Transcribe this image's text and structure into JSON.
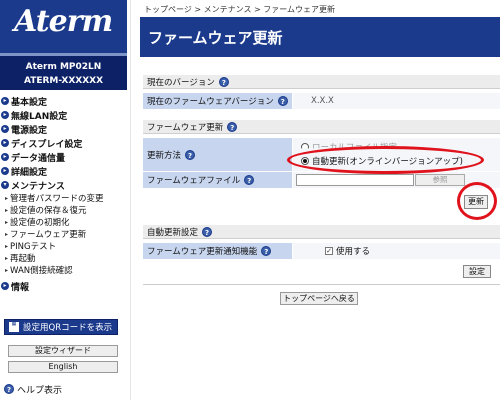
{
  "sidebar": {
    "logo_text": "Aterm",
    "model_line1": "Aterm   MP02LN",
    "model_line2": "ATERM-XXXXXX",
    "nav": [
      {
        "label": "基本設定"
      },
      {
        "label": "無線LAN設定"
      },
      {
        "label": "電源設定"
      },
      {
        "label": "ディスプレイ設定"
      },
      {
        "label": "データ通信量"
      },
      {
        "label": "詳細設定"
      },
      {
        "label": "メンテナンス"
      }
    ],
    "maintenance_items": [
      {
        "label": "管理者パスワードの変更"
      },
      {
        "label": "設定値の保存＆復元"
      },
      {
        "label": "設定値の初期化"
      },
      {
        "label": "ファームウェア更新"
      },
      {
        "label": "PINGテスト"
      },
      {
        "label": "再起動"
      },
      {
        "label": "WAN側接続確認"
      }
    ],
    "info_label": "情報",
    "qr_button": "設定用QRコードを表示",
    "wizard_button": "設定ウィザード",
    "english_button": "English",
    "help_label": "ヘルプ表示"
  },
  "main": {
    "breadcrumb": "トップページ > メンテナンス > ファームウェア更新",
    "title": "ファームウェア更新",
    "current_version_section": "現在のバージョン",
    "current_version_label": "現在のファームウェアバージョン",
    "current_version_value": "X.X.X",
    "firmware_section": "ファームウェア更新",
    "update_method_label": "更新方法",
    "radio_local": "ローカルファイル指定",
    "radio_auto": "自動更新(オンラインバージョンアップ)",
    "firmware_file_label": "ファームウェアファイル",
    "browse_button": "参照",
    "update_button": "更新",
    "auto_update_section": "自動更新設定",
    "notify_label": "ファームウェア更新通知機能",
    "notify_checkbox_label": "使用する",
    "settings_button": "設定",
    "top_page_button": "トップページへ戻る",
    "help_glyph": "?"
  },
  "colors": {
    "brand_blue": "#1b3a8c",
    "label_cell": "#c7d5ee",
    "annotation_red": "#e0121b"
  }
}
